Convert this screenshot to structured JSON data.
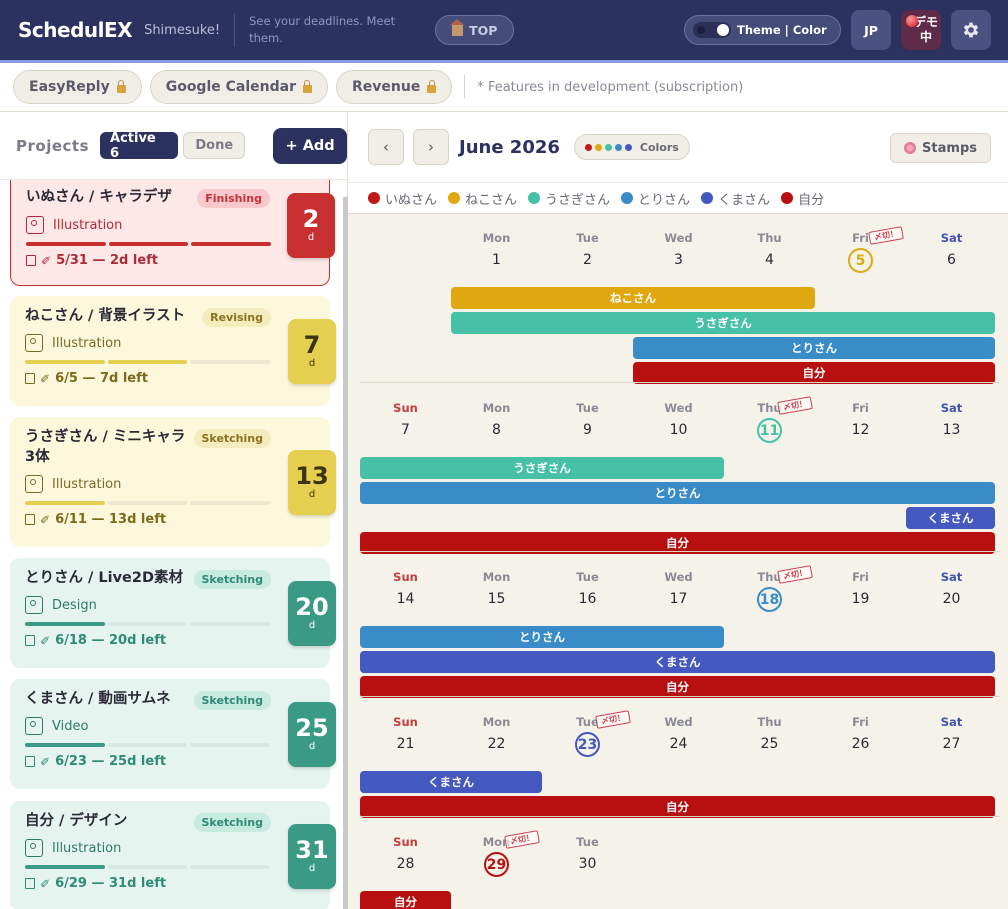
{
  "header": {
    "logo": "SchedulEX",
    "subname": "Shimesuke!",
    "tagline": "See your deadlines. Meet them.",
    "top_label": "TOP",
    "theme_label": "Theme | Color",
    "lang_label": "JP",
    "demo_label": "デモ中",
    "settings_icon": "gear-icon"
  },
  "features": {
    "items": [
      {
        "label": "EasyReply",
        "icon": "lock-icon"
      },
      {
        "label": "Google Calendar",
        "icon": "lock-icon"
      },
      {
        "label": "Revenue",
        "icon": "lock-icon"
      }
    ],
    "note": "* Features in development (subscription)"
  },
  "sidebar": {
    "title": "Projects",
    "active_label": "Active 6",
    "done_label": "Done",
    "add_label": "+ Add",
    "projects": [
      {
        "title": "いぬさん / キャラデザ",
        "status": "Finishing",
        "category": "Illustration",
        "category_icon": "illustration-icon",
        "deadline": "5/31 — 2d left",
        "days": "2",
        "unit": "d",
        "progress_steps": 3,
        "progress_total": 3,
        "theme": "red"
      },
      {
        "title": "ねこさん / 背景イラスト",
        "status": "Revising",
        "category": "Illustration",
        "category_icon": "illustration-icon",
        "deadline": "6/5 — 7d left",
        "days": "7",
        "unit": "d",
        "progress_steps": 2,
        "progress_total": 3,
        "theme": "yellow"
      },
      {
        "title": "うさぎさん / ミニキャラ3体",
        "status": "Sketching",
        "category": "Illustration",
        "category_icon": "illustration-icon",
        "deadline": "6/11 — 13d left",
        "days": "13",
        "unit": "d",
        "progress_steps": 1,
        "progress_total": 3,
        "theme": "yellow"
      },
      {
        "title": "とりさん / Live2D素材",
        "status": "Sketching",
        "category": "Design",
        "category_icon": "design-icon",
        "deadline": "6/18 — 20d left",
        "days": "20",
        "unit": "d",
        "progress_steps": 1,
        "progress_total": 3,
        "theme": "green"
      },
      {
        "title": "くまさん / 動画サムネ",
        "status": "Sketching",
        "category": "Video",
        "category_icon": "video-icon",
        "deadline": "6/23 — 25d left",
        "days": "25",
        "unit": "d",
        "progress_steps": 1,
        "progress_total": 3,
        "theme": "green"
      },
      {
        "title": "自分 / デザイン",
        "status": "Sketching",
        "category": "Illustration",
        "category_icon": "illustration-icon",
        "deadline": "6/29 — 31d left",
        "days": "31",
        "unit": "d",
        "progress_steps": 1,
        "progress_total": 3,
        "theme": "green"
      }
    ]
  },
  "calendar": {
    "prev_label": "‹",
    "next_label": "›",
    "month": "June 2026",
    "colors_label": "Colors",
    "stamps_label": "Stamps",
    "stamp_text": "〆切！",
    "legend": [
      {
        "name": "いぬさん",
        "color": "#c01818"
      },
      {
        "name": "ねこさん",
        "color": "#e0a810"
      },
      {
        "name": "うさぎさん",
        "color": "#46c0a6"
      },
      {
        "name": "とりさん",
        "color": "#3a8cc8"
      },
      {
        "name": "くまさん",
        "color": "#4458c0"
      },
      {
        "name": "自分",
        "color": "#b81010"
      }
    ],
    "weeks": [
      {
        "days": [
          {
            "name": "",
            "num": ""
          },
          {
            "name": "Mon",
            "num": "1"
          },
          {
            "name": "Tue",
            "num": "2"
          },
          {
            "name": "Wed",
            "num": "3"
          },
          {
            "name": "Thu",
            "num": "4"
          },
          {
            "name": "Fri",
            "num": "5",
            "deadline": "ねこさん"
          },
          {
            "name": "Sat",
            "num": "6"
          }
        ],
        "bars": [
          {
            "label": "ねこさん",
            "start": 1,
            "end": 4
          },
          {
            "label": "うさぎさん",
            "start": 1,
            "end": 6
          },
          {
            "label": "とりさん",
            "start": 3,
            "end": 6
          },
          {
            "label": "自分",
            "start": 3,
            "end": 6
          }
        ]
      },
      {
        "days": [
          {
            "name": "Sun",
            "num": "7"
          },
          {
            "name": "Mon",
            "num": "8"
          },
          {
            "name": "Tue",
            "num": "9"
          },
          {
            "name": "Wed",
            "num": "10"
          },
          {
            "name": "Thu",
            "num": "11",
            "deadline": "うさぎさん"
          },
          {
            "name": "Fri",
            "num": "12"
          },
          {
            "name": "Sat",
            "num": "13"
          }
        ],
        "bars": [
          {
            "label": "うさぎさん",
            "start": 0,
            "end": 3
          },
          {
            "label": "とりさん",
            "start": 0,
            "end": 6
          },
          {
            "label": "くまさん",
            "start": 6,
            "end": 6
          },
          {
            "label": "自分",
            "start": 0,
            "end": 6
          }
        ]
      },
      {
        "days": [
          {
            "name": "Sun",
            "num": "14"
          },
          {
            "name": "Mon",
            "num": "15"
          },
          {
            "name": "Tue",
            "num": "16"
          },
          {
            "name": "Wed",
            "num": "17"
          },
          {
            "name": "Thu",
            "num": "18",
            "deadline": "とりさん"
          },
          {
            "name": "Fri",
            "num": "19"
          },
          {
            "name": "Sat",
            "num": "20"
          }
        ],
        "bars": [
          {
            "label": "とりさん",
            "start": 0,
            "end": 3
          },
          {
            "label": "くまさん",
            "start": 0,
            "end": 6
          },
          {
            "label": "自分",
            "start": 0,
            "end": 6
          }
        ]
      },
      {
        "days": [
          {
            "name": "Sun",
            "num": "21"
          },
          {
            "name": "Mon",
            "num": "22"
          },
          {
            "name": "Tue",
            "num": "23",
            "deadline": "くまさん"
          },
          {
            "name": "Wed",
            "num": "24"
          },
          {
            "name": "Thu",
            "num": "25"
          },
          {
            "name": "Fri",
            "num": "26"
          },
          {
            "name": "Sat",
            "num": "27"
          }
        ],
        "bars": [
          {
            "label": "くまさん",
            "start": 0,
            "end": 1
          },
          {
            "label": "自分",
            "start": 0,
            "end": 6
          }
        ]
      },
      {
        "days": [
          {
            "name": "Sun",
            "num": "28"
          },
          {
            "name": "Mon",
            "num": "29",
            "deadline": "自分"
          },
          {
            "name": "Tue",
            "num": "30"
          }
        ],
        "bars": [
          {
            "label": "自分",
            "start": 0,
            "end": 0
          }
        ]
      }
    ]
  },
  "colors": {
    "navy": "#2c3260",
    "deadline_stamp": "#d04050",
    "card_red_bg": "#fde7e7",
    "card_yellow_bg": "#fdf8dc",
    "card_green_bg": "#e6f4f0",
    "red_accent": "#c83030",
    "yellow_accent": "#e4cf50",
    "green_accent": "#3a9a86"
  }
}
